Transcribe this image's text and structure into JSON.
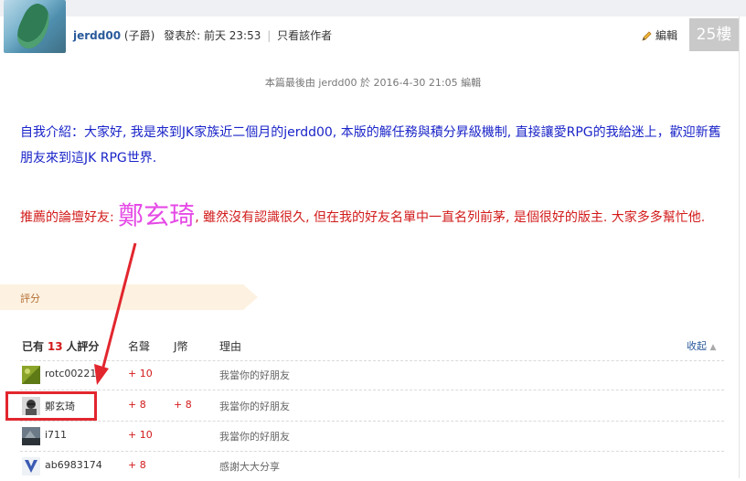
{
  "post": {
    "author": "jerdd00",
    "rank": "(子爵)",
    "posted_label": "發表於: 前天 23:53",
    "only_author_label": "只看該作者",
    "edit_label": "編輯",
    "floor": "25樓",
    "edit_note": "本篇最後由 jerdd00 於 2016-4-30 21:05 編輯",
    "intro": "自我介紹：大家好, 我是來到JK家族近二個月的jerdd00, 本版的解任務與積分昇級機制, 直接讓愛RPG的我給迷上，歡迎新舊朋友來到這JK RPG世界.",
    "recommend_prefix": "推薦的論壇好友:",
    "recommend_name": "鄭玄琦",
    "recommend_suffix": ", 雖然沒有認識很久, 但在我的好友名單中一直名列前茅, 是個很好的版主. 大家多多幫忙他."
  },
  "rating": {
    "tab_label": "評分",
    "header_prefix": "已有",
    "header_count": "13",
    "header_suffix": "人評分",
    "col_reputation": "名聲",
    "col_jcoin": "J幣",
    "col_reason": "理由",
    "collapse_label": "收起",
    "rows": [
      {
        "user": "rotc00221",
        "rep": "+ 10",
        "jcoin": "",
        "reason": "我當你的好朋友"
      },
      {
        "user": "鄭玄琦",
        "rep": "+ 8",
        "jcoin": "+ 8",
        "reason": "我當你的好朋友"
      },
      {
        "user": "i711",
        "rep": "+ 10",
        "jcoin": "",
        "reason": "我當你的好朋友"
      },
      {
        "user": "ab6983174",
        "rep": "+ 8",
        "jcoin": "",
        "reason": "感謝大大分享"
      }
    ]
  },
  "colors": {
    "intro_text": "#1a24c8",
    "recommend_text": "#d21a1a",
    "name_highlight": "#e54ae6",
    "annotation_red": "#e2262e"
  }
}
